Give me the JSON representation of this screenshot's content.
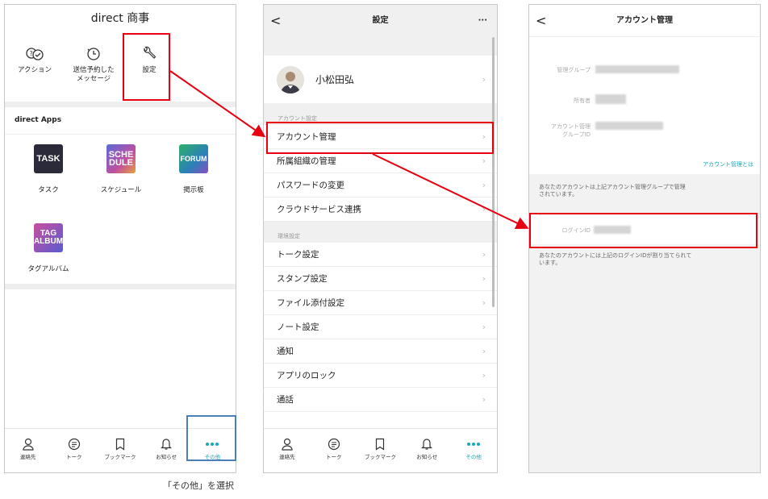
{
  "screen1": {
    "title": "direct 商事",
    "actions": [
      {
        "label": "アクション",
        "icon": "actions-icon"
      },
      {
        "label": "送信予約した\nメッセージ",
        "icon": "clock-icon"
      },
      {
        "label": "設定",
        "icon": "wrench-icon"
      }
    ],
    "apps_title": "direct Apps",
    "apps": [
      {
        "tile": "TASK",
        "label": "タスク",
        "color": "#2a2a3a"
      },
      {
        "tile": "SCHE\nDULE",
        "label": "スケジュール",
        "color": "#8a4fc0"
      },
      {
        "tile": "FORUM",
        "label": "掲示板",
        "color": "#2f8f7a"
      },
      {
        "tile": "TAG\nALBUM",
        "label": "タグアルバム",
        "color": "#7a4a9a"
      }
    ]
  },
  "tabs": [
    "連絡先",
    "トーク",
    "ブックマーク",
    "お知らせ",
    "その他"
  ],
  "screen2": {
    "title": "設定",
    "more": "···",
    "back": "<",
    "profile_name": "小松田弘",
    "section_account": "アカウント設定",
    "account_items": [
      "アカウント管理",
      "所属組織の管理",
      "パスワードの変更",
      "クラウドサービス連携"
    ],
    "section_env": "環境設定",
    "env_items": [
      "トーク設定",
      "スタンプ設定",
      "ファイル添付設定",
      "ノート設定",
      "通知",
      "アプリのロック",
      "通話"
    ]
  },
  "screen3": {
    "title": "アカウント管理",
    "back": "<",
    "field_group": "管理グループ",
    "field_owner": "所有者",
    "field_groupid_1": "アカウント管理",
    "field_groupid_2": "グループID",
    "link": "アカウント管理とは",
    "note1_1": "あなたのアカウントは上記アカウント管理グループで管理",
    "note1_2": "されています。",
    "field_login": "ログインID",
    "note2_1": "あなたのアカウントには上記のログインIDが割り当てられて",
    "note2_2": "います。"
  },
  "caption": "「その他」を選択",
  "colors": {
    "accent": "#14a9b6",
    "highlight_red": "#e60012",
    "highlight_blue": "#4a7fb8"
  }
}
